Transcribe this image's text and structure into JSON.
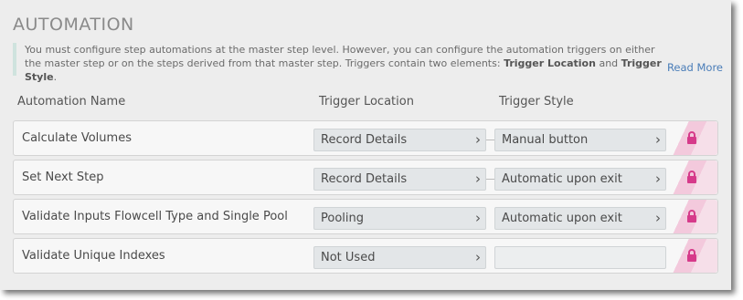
{
  "title": "AUTOMATION",
  "info": {
    "text_part1": "You must configure step automations at the master step level. However, you can configure the automation triggers on either the master step or on the steps derived from that master step. Triggers contain two elements: ",
    "bold1": "Trigger Location",
    "text_part2": " and ",
    "bold2": "Trigger Style",
    "text_part3": ".",
    "read_more": "Read More"
  },
  "columns": {
    "name": "Automation Name",
    "location": "Trigger Location",
    "style": "Trigger Style"
  },
  "rows": [
    {
      "name": "Calculate Volumes",
      "location": "Record Details",
      "style": "Manual button"
    },
    {
      "name": "Set Next Step",
      "location": "Record Details",
      "style": "Automatic upon exit"
    },
    {
      "name": "Validate Inputs Flowcell Type and Single Pool",
      "location": "Pooling",
      "style": "Automatic upon exit"
    },
    {
      "name": "Validate Unique Indexes",
      "location": "Not Used",
      "style": ""
    }
  ],
  "icons": {
    "chevron": "chevron-right-icon",
    "lock": "lock-icon"
  },
  "colors": {
    "accent_link": "#4a7db8",
    "lock": "#d63a8a",
    "lock_highlight": "#f3c9dc"
  }
}
